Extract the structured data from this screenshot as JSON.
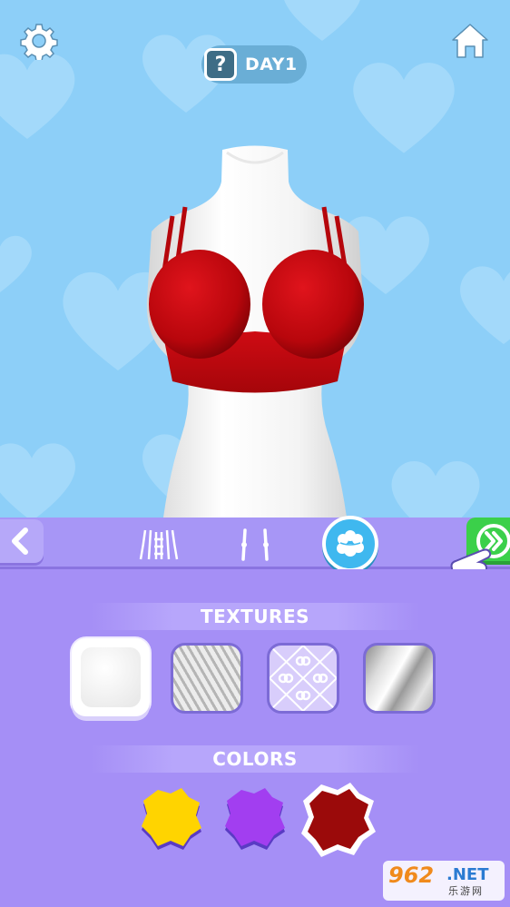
{
  "top": {
    "settings_icon": "gear-icon",
    "home_icon": "home-icon",
    "help_badge": "?",
    "day_label": "DAY1"
  },
  "toolbar": {
    "back_icon": "chevron-left-icon",
    "tools": [
      "corset-icon",
      "straps-icon",
      "texture-icon"
    ],
    "active_tool": "texture-icon",
    "next_icon": "double-chevron-right-icon",
    "hand_pointer_icon": "hand-pointer-icon"
  },
  "panel": {
    "textures_title": "TEXTURES",
    "textures": [
      "plain-white",
      "knit-gray",
      "pattern-lavender",
      "metallic-silver"
    ],
    "selected_texture": "plain-white",
    "colors_title": "COLORS",
    "colors": [
      "#ffd400",
      "#a23ef0",
      "#9b0a0a"
    ],
    "selected_color": "#9b0a0a"
  },
  "watermark": {
    "brand_number": "962",
    "brand_suffix": ".NET",
    "brand_cn": "乐游网"
  },
  "colors": {
    "sky": "#8dcff8",
    "panel": "#a58ff6",
    "garment_red": "#c4080e",
    "accent_blue": "#3fb8ef",
    "accent_green": "#3bd04a"
  }
}
